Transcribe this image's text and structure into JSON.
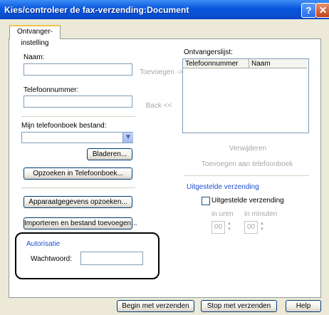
{
  "window": {
    "title": "Kies/controleer de fax-verzending:Document",
    "help_glyph": "?",
    "close_glyph": "✕"
  },
  "tabs": [
    "Ontvanger-instelling"
  ],
  "left": {
    "name_label": "Naam:",
    "name_value": "",
    "phone_label": "Telefoonnummer:",
    "phone_value": "",
    "phonebook_file_label": "Mijn telefoonboek bestand:",
    "phonebook_file_value": "",
    "browse_button": "Bladeren...",
    "lookup_phonebook_button": "Opzoeken in Telefoonboek...",
    "device_data_button": "Apparaatgegevens opzoeken...",
    "import_file_button": "Importeren en bestand toevoegen...",
    "auth_section": "Autorisatie",
    "password_label": "Wachtwoord:",
    "password_value": ""
  },
  "middle": {
    "add_button": "Toevoegen ->",
    "back_button": "Back <<"
  },
  "right": {
    "recipients_label": "Ontvangerslijst:",
    "columns": [
      "Telefoonnummer",
      "Naam"
    ],
    "rows": [],
    "delete_button": "Verwijderen",
    "add_to_phonebook_button": "Toevoegen aan telefoonboek",
    "delayed_section": "Uitgestelde verzending",
    "delayed_checkbox_label": "Uitgestelde verzending",
    "delayed_checked": false,
    "hours_label": "in uren",
    "minutes_label": "in minuten",
    "hours_value": "00",
    "minutes_value": "00"
  },
  "footer": {
    "start_button": "Begin met verzenden",
    "stop_button": "Stop met verzenden",
    "help_button": "Help"
  },
  "colors": {
    "titlebar": "#0855dd",
    "section_header": "#1f4fd0",
    "disabled_text": "#a7a7a7"
  }
}
